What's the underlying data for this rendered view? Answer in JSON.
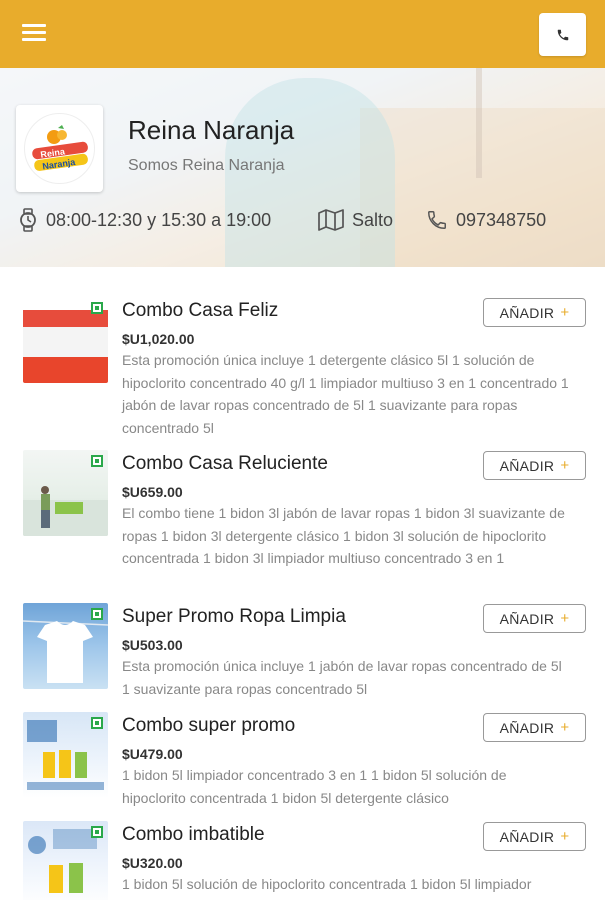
{
  "header": {
    "menu_icon": "hamburger-menu-icon",
    "call_icon": "phone-icon"
  },
  "store": {
    "name": "Reina Naranja",
    "tagline": "Somos Reina Naranja",
    "logo_text": "Reina Naranja",
    "hours": "08:00-12:30 y 15:30 a 19:00",
    "city": "Salto",
    "phone": "097348750"
  },
  "colors": {
    "brand": "#e8ac2c",
    "veg_mark": "#2aa84a"
  },
  "products": [
    {
      "title": "Combo Casa Feliz",
      "price": "$U1,020.00",
      "description": "Esta promoción única incluye 1 detergente clásico 5l 1 solución de hipoclorito concentrado 40 g/l 1 limpiador multiuso 3 en 1 concentrado 1 jabón de lavar ropas concentrado de 5l 1 suavizante para ropas concentrado 5l",
      "button_label": "AÑADIR",
      "button_icon": "+"
    },
    {
      "title": "Combo Casa Reluciente",
      "price": "$U659.00",
      "description": "El combo tiene 1 bidon 3l jabón de lavar ropas 1 bidon 3l suavizante de ropas 1 bidon 3l detergente clásico 1 bidon 3l solución de hipoclorito concentrada 1 bidon 3l limpiador multiuso concentrado 3 en 1",
      "button_label": "AÑADIR",
      "button_icon": "+"
    },
    {
      "title": "Super Promo Ropa Limpia",
      "price": "$U503.00",
      "description": "Esta promoción única incluye 1 jabón de lavar ropas concentrado de 5l 1 suavizante para ropas concentrado 5l",
      "button_label": "AÑADIR",
      "button_icon": "+"
    },
    {
      "title": "Combo super promo",
      "price": "$U479.00",
      "description": "1 bidon 5l limpiador concentrado 3 en 1 1 bidon 5l solución de hipoclorito concentrada 1 bidon 5l detergente clásico",
      "button_label": "AÑADIR",
      "button_icon": "+"
    },
    {
      "title": "Combo imbatible",
      "price": "$U320.00",
      "description": "1 bidon 5l solución de hipoclorito concentrada 1 bidon 5l limpiador",
      "button_label": "AÑADIR",
      "button_icon": "+"
    }
  ]
}
